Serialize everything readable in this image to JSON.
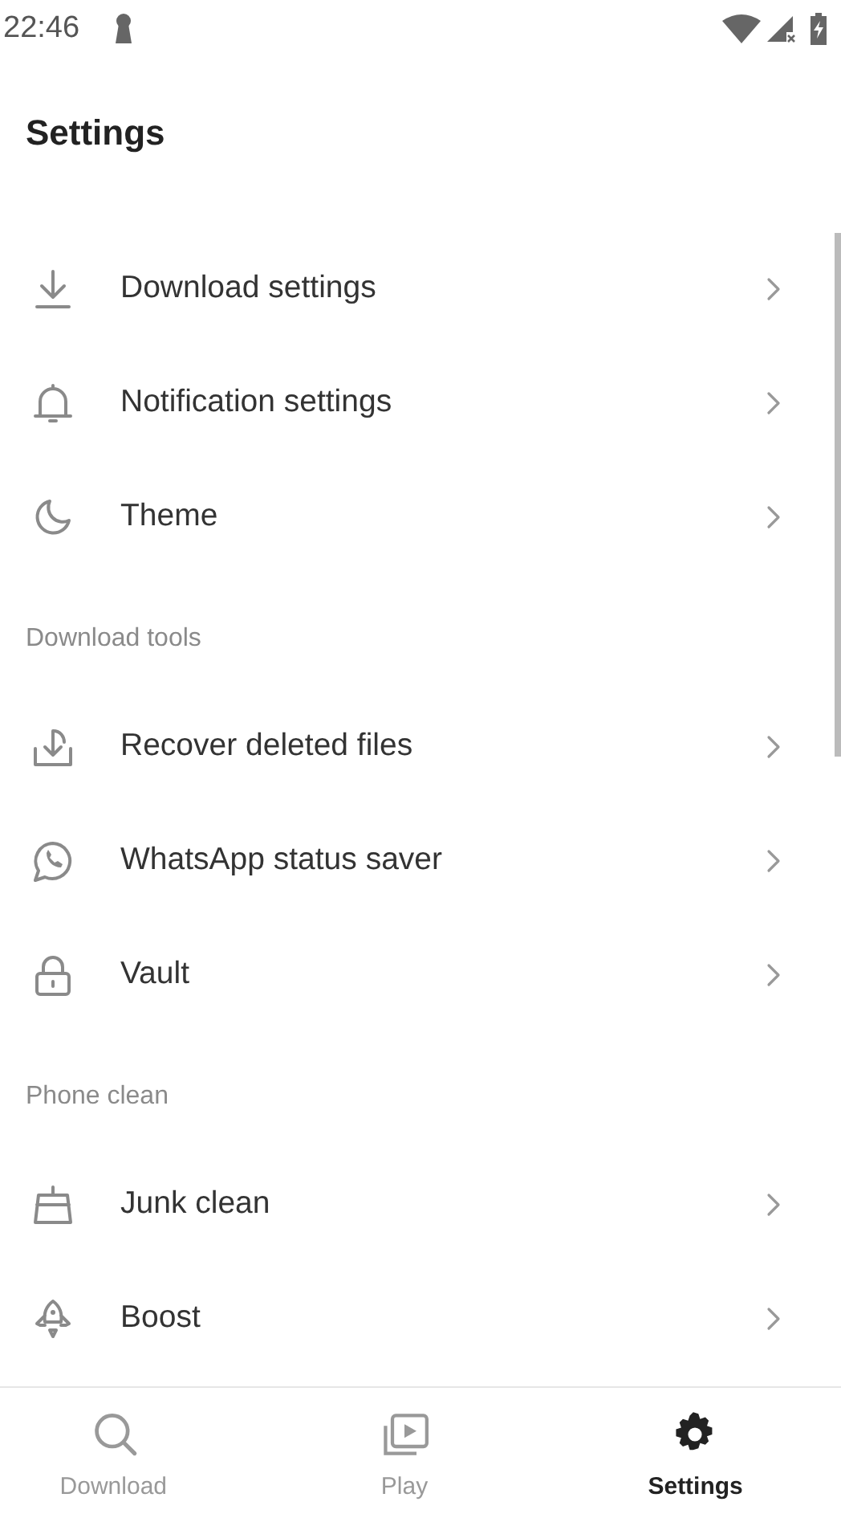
{
  "status_bar": {
    "time": "22:46"
  },
  "title": "Settings",
  "sections": [
    {
      "items": [
        {
          "label": "Download settings"
        },
        {
          "label": "Notification settings"
        },
        {
          "label": "Theme"
        }
      ]
    },
    {
      "header": "Download tools",
      "items": [
        {
          "label": "Recover deleted files"
        },
        {
          "label": "WhatsApp status saver"
        },
        {
          "label": "Vault"
        }
      ]
    },
    {
      "header": "Phone clean",
      "items": [
        {
          "label": "Junk clean"
        },
        {
          "label": "Boost"
        }
      ]
    }
  ],
  "bottom_nav": [
    {
      "label": "Download",
      "selected": false
    },
    {
      "label": "Play",
      "selected": false
    },
    {
      "label": "Settings",
      "selected": true
    }
  ]
}
